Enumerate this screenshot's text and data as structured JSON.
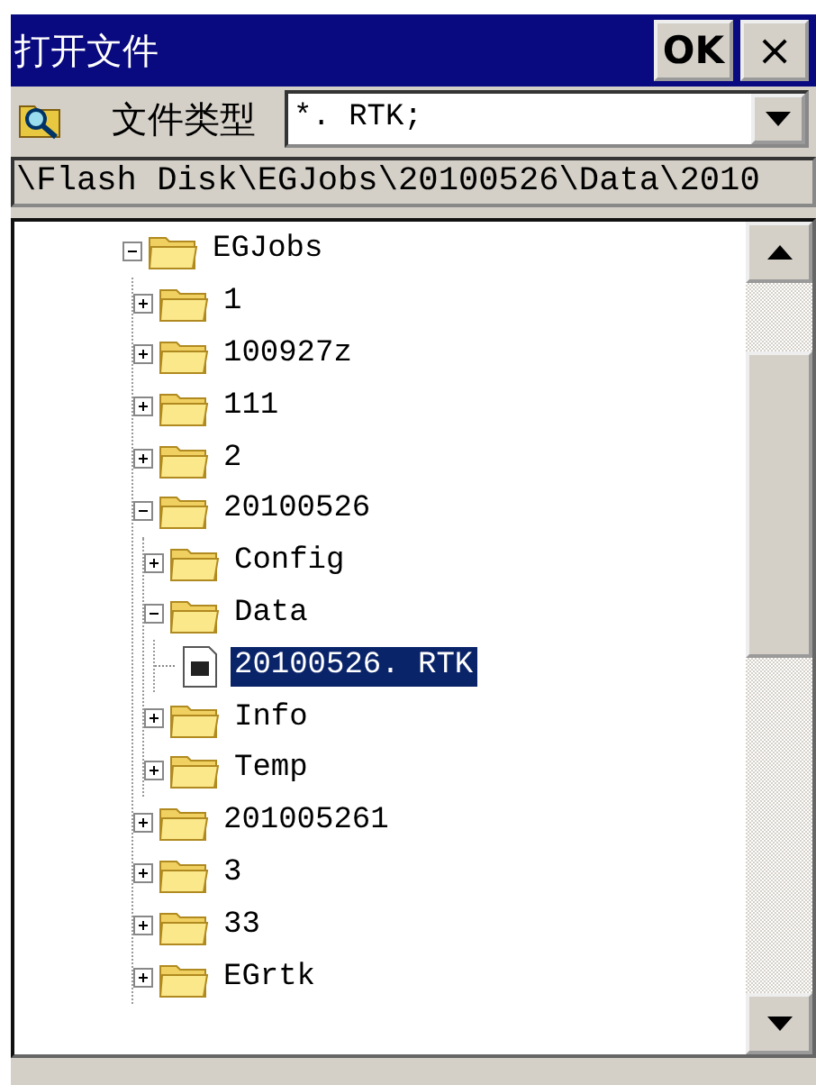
{
  "window": {
    "title": "打开文件",
    "buttons": [
      {
        "kind": "ok",
        "label": "OK"
      },
      {
        "kind": "close",
        "label": "×"
      }
    ]
  },
  "file_type": {
    "label": "文件类型",
    "value": "*. RTK;"
  },
  "path": {
    "value": "\\Flash Disk\\EGJobs\\20100526\\Data\\2010"
  },
  "tree": [
    {
      "kind": "folder",
      "label": "EGJobs",
      "expanded": true,
      "selected": false,
      "children": [
        {
          "kind": "folder",
          "label": "1",
          "expanded": false,
          "selected": false
        },
        {
          "kind": "folder",
          "label": "100927z",
          "expanded": false,
          "selected": false
        },
        {
          "kind": "folder",
          "label": "111",
          "expanded": false,
          "selected": false
        },
        {
          "kind": "folder",
          "label": "2",
          "expanded": false,
          "selected": false
        },
        {
          "kind": "folder",
          "label": "20100526",
          "expanded": true,
          "selected": false,
          "children": [
            {
              "kind": "folder",
              "label": "Config",
              "expanded": false,
              "selected": false
            },
            {
              "kind": "folder",
              "label": "Data",
              "expanded": true,
              "selected": false,
              "children": [
                {
                  "kind": "file",
                  "label": "20100526. RTK",
                  "selected": true
                }
              ]
            },
            {
              "kind": "folder",
              "label": "Info",
              "expanded": false,
              "selected": false
            },
            {
              "kind": "folder",
              "label": "Temp",
              "expanded": false,
              "selected": false
            }
          ]
        },
        {
          "kind": "folder",
          "label": "201005261",
          "expanded": false,
          "selected": false
        },
        {
          "kind": "folder",
          "label": "3",
          "expanded": false,
          "selected": false
        },
        {
          "kind": "folder",
          "label": "33",
          "expanded": false,
          "selected": false
        },
        {
          "kind": "folder",
          "label": "EGrtk",
          "expanded": false,
          "selected": false
        }
      ]
    }
  ]
}
